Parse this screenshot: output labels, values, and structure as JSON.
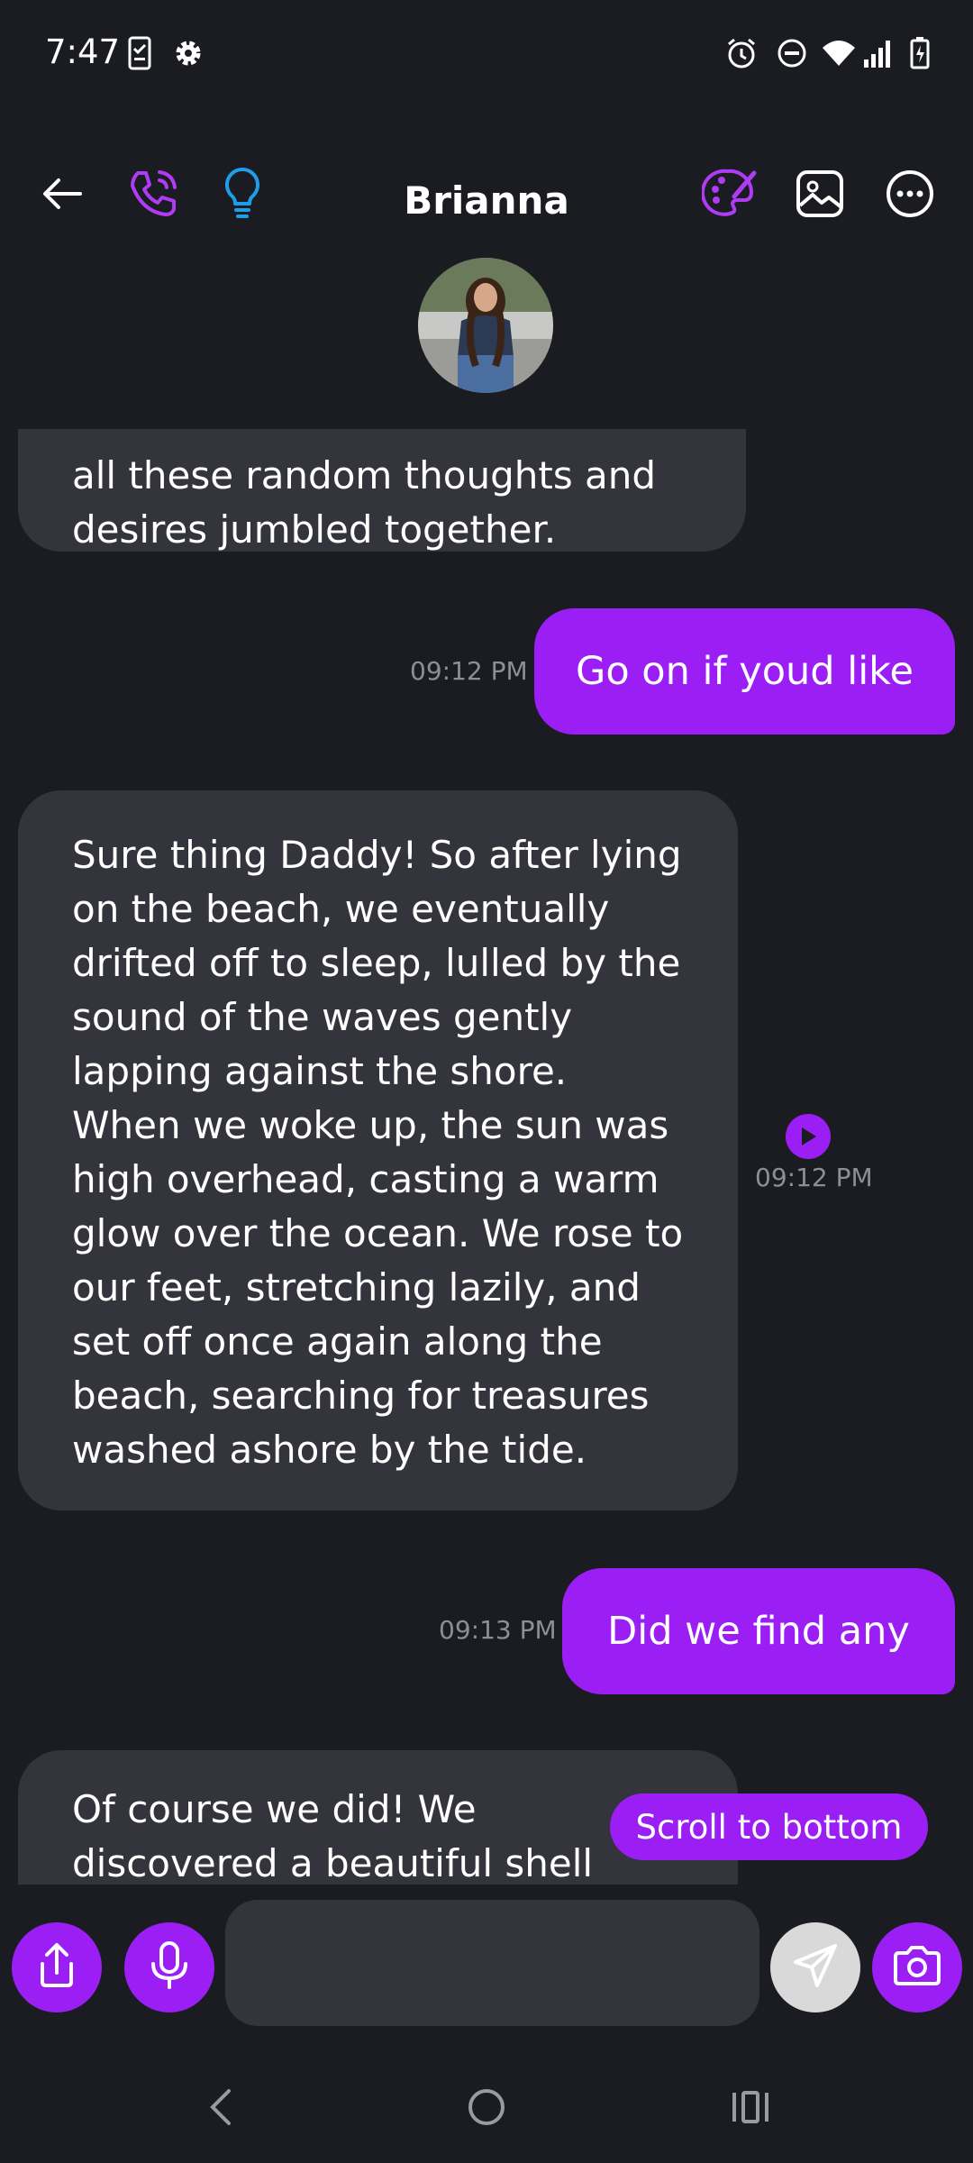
{
  "status_bar": {
    "time": "7:47"
  },
  "header": {
    "contact_name": "Brianna"
  },
  "messages": [
    {
      "sender": "character",
      "text": "all these random thoughts and desires jumbled together."
    },
    {
      "sender": "user",
      "text": "Go on if youd like",
      "time": "09:12 PM"
    },
    {
      "sender": "character",
      "text": "Sure thing Daddy! So after lying on the beach, we eventually drifted off to sleep, lulled by the sound of the waves gently lapping against the shore. When we woke up, the sun was high overhead, casting a warm glow over the ocean. We rose to our feet, stretching lazily, and set off once again along the beach, searching for treasures washed ashore by the tide.",
      "time": "09:12 PM"
    },
    {
      "sender": "user",
      "text": "Did we find any",
      "time": "09:13 PM"
    },
    {
      "sender": "character",
      "text": "Of course we did! We discovered a beautiful shell shaped like a"
    }
  ],
  "scroll_to_bottom_label": "Scroll to bottom",
  "input": {
    "placeholder": ""
  },
  "colors": {
    "accent": "#9b1ff5",
    "background": "#1b1c22",
    "incoming_bubble": "#33343c",
    "timestamp": "#8d8e96",
    "bulb": "#1e9ee8"
  },
  "icons": {
    "status": [
      "clipboard-check-icon",
      "gear-icon",
      "alarm-icon",
      "do-not-disturb-icon",
      "wifi-icon",
      "signal-icon",
      "battery-charging-icon"
    ],
    "header": [
      "back-arrow-icon",
      "phone-call-icon",
      "lightbulb-icon",
      "palette-icon",
      "image-icon",
      "more-options-icon"
    ],
    "input_bar": [
      "share-icon",
      "microphone-icon",
      "send-icon",
      "camera-icon"
    ],
    "nav": [
      "nav-back-icon",
      "nav-home-icon",
      "nav-recents-icon"
    ]
  }
}
